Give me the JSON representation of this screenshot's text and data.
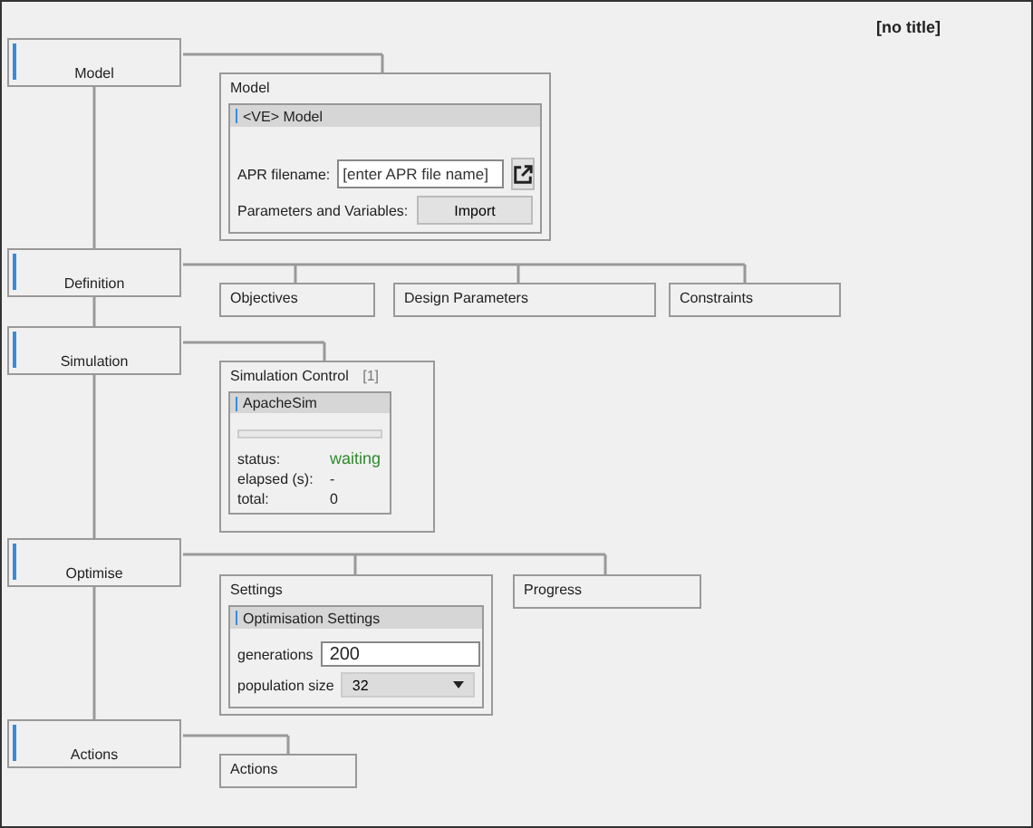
{
  "title": "[no title]",
  "stages": [
    {
      "label": "Model",
      "panels": [
        {
          "kind": "model",
          "title": "Model",
          "group_title": "<VE> Model",
          "apr_label": "APR filename:",
          "apr_placeholder": "[enter APR file name]",
          "params_label": "Parameters and Variables:",
          "import_button": "Import"
        }
      ]
    },
    {
      "label": "Definition",
      "panels": [
        {
          "kind": "box",
          "title": "Objectives"
        },
        {
          "kind": "box",
          "title": "Design Parameters"
        },
        {
          "kind": "box",
          "title": "Constraints"
        }
      ]
    },
    {
      "label": "Simulation",
      "panels": [
        {
          "kind": "simulation",
          "title": "Simulation Control",
          "count": "[1]",
          "group_title": "ApacheSim",
          "level": 0,
          "status_label": "status:",
          "status": "waiting",
          "elapsed_label": "elapsed (s):",
          "elapsed": "-",
          "total_label": "total:",
          "total": "0"
        }
      ]
    },
    {
      "label": "Optimise",
      "panels": [
        {
          "kind": "settings",
          "title": "Settings",
          "group_title": "Optimisation Settings",
          "generations_label": "generations",
          "generations": "200",
          "population_label": "population size",
          "population": "32"
        },
        {
          "kind": "box",
          "title": "Progress"
        }
      ]
    },
    {
      "label": "Actions",
      "panels": [
        {
          "kind": "box",
          "title": "Actions"
        }
      ]
    }
  ]
}
